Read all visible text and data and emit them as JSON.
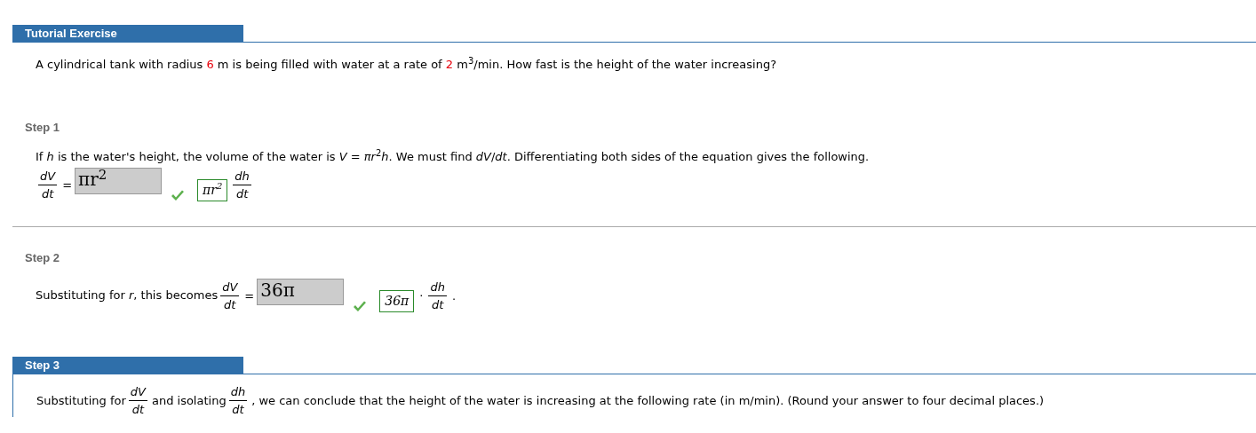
{
  "header": {
    "title": "Tutorial Exercise"
  },
  "problem": {
    "segments": [
      {
        "kind": "text",
        "text": "A cylindrical tank with radius "
      },
      {
        "kind": "given",
        "text": "6"
      },
      {
        "kind": "text",
        "text": " m is being filled with water at a rate of "
      },
      {
        "kind": "given",
        "text": "2"
      },
      {
        "kind": "text",
        "text": " m$^{3}$/min. How fast is the height of the water increasing?"
      }
    ]
  },
  "steps": [
    {
      "label": "Step 1",
      "current": false,
      "lines": [
        [
          {
            "kind": "text",
            "text": "If *h* is the water's height, the volume of the water is *V* = *πr*$^{2}$*h*. We must find *dV*/*dt*. Differentiating both sides of the equation gives the following."
          }
        ],
        [
          {
            "kind": "frac",
            "num": "dV",
            "den": "dt"
          },
          {
            "kind": "op",
            "text": "="
          },
          {
            "kind": "field",
            "value": "πr$^{2}$",
            "correct": true
          },
          {
            "kind": "key",
            "text": "πr$^{2}$"
          },
          {
            "kind": "frac",
            "num": "dh",
            "den": "dt"
          }
        ]
      ]
    },
    {
      "label": "Step 2",
      "current": false,
      "lines": [
        [
          {
            "kind": "text",
            "text": "Substituting for *r*, this becomes"
          },
          {
            "kind": "frac",
            "num": "dV",
            "den": "dt"
          },
          {
            "kind": "op",
            "text": "="
          },
          {
            "kind": "field",
            "value": "36π",
            "correct": true
          },
          {
            "kind": "key",
            "text": "36π"
          },
          {
            "kind": "op",
            "text": "·"
          },
          {
            "kind": "frac",
            "num": "dh",
            "den": "dt"
          },
          {
            "kind": "op",
            "text": "."
          }
        ]
      ]
    },
    {
      "label": "Step 3",
      "current": true,
      "lines": [
        [
          {
            "kind": "text",
            "text": "Substituting for"
          },
          {
            "kind": "frac",
            "num": "dV",
            "den": "dt"
          },
          {
            "kind": "text",
            "text": "and isolating"
          },
          {
            "kind": "frac",
            "num": "dh",
            "den": "dt"
          },
          {
            "kind": "text",
            "text": ", we can conclude that the height of the water is increasing at the following rate (in m/min). (Round your answer to four decimal places.)"
          }
        ]
      ]
    }
  ]
}
